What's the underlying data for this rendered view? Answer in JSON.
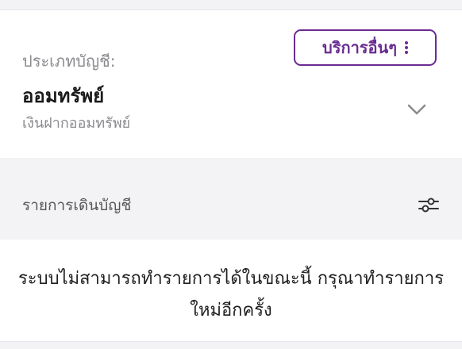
{
  "account": {
    "type_label": "ประเภทบัญชี:",
    "name": "ออมทรัพย์",
    "subtitle": "เงินฝากออมทรัพย์",
    "more_services_label": "บริการอื่นๆ"
  },
  "transactions": {
    "title": "รายการเดินบัญชี",
    "message": "ระบบไม่สามารถทำรายการได้ในขณะนี้ กรุณาทำรายการใหม่อีกครั้ง"
  },
  "icons": {
    "more": "vertical-dots-icon",
    "expand": "chevron-down-icon",
    "filter": "filter-sliders-icon"
  },
  "colors": {
    "accent": "#6a2c91",
    "background": "#f3f3f5",
    "card": "#ffffff",
    "muted_text": "#8a8a8f"
  }
}
